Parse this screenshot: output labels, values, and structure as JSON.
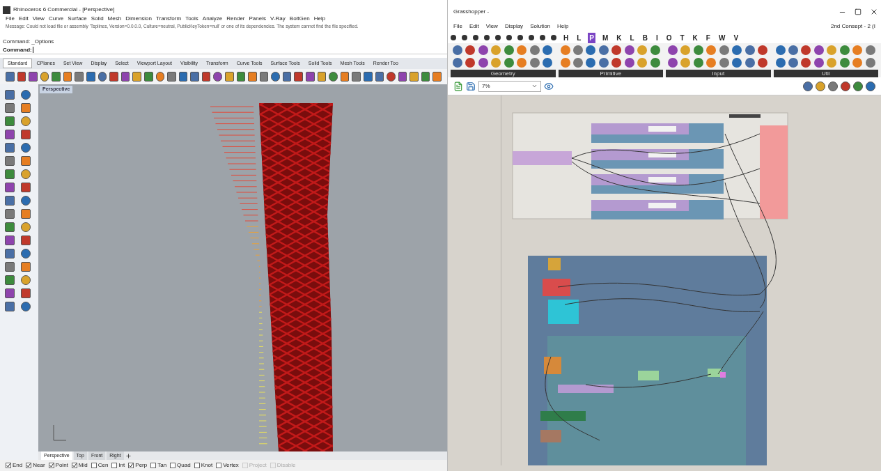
{
  "rhino": {
    "title": "Rhinoceros 6 Commercial - [Perspective]",
    "menu": [
      "File",
      "Edit",
      "View",
      "Curve",
      "Surface",
      "Solid",
      "Mesh",
      "Dimension",
      "Transform",
      "Tools",
      "Analyze",
      "Render",
      "Panels",
      "V-Ray",
      "BoltGen",
      "Help"
    ],
    "message": "Message: Could not load file or assembly 'Tsplines, Version=0.0.0.0, Culture=neutral, PublicKeyToken=null' or one of its dependencies. The system cannot find the file specified.",
    "command_history": "Command: _Options",
    "command_prompt": "Command:",
    "toolbar_tabs": [
      {
        "label": "Standard",
        "selected": true
      },
      {
        "label": "CPlanes",
        "selected": false
      },
      {
        "label": "Set View",
        "selected": false
      },
      {
        "label": "Display",
        "selected": false
      },
      {
        "label": "Select",
        "selected": false
      },
      {
        "label": "Viewport Layout",
        "selected": false
      },
      {
        "label": "Visibility",
        "selected": false
      },
      {
        "label": "Transform",
        "selected": false
      },
      {
        "label": "Curve Tools",
        "selected": false
      },
      {
        "label": "Surface Tools",
        "selected": false
      },
      {
        "label": "Solid Tools",
        "selected": false
      },
      {
        "label": "Mesh Tools",
        "selected": false
      },
      {
        "label": "Render Too",
        "selected": false
      }
    ],
    "viewport_title": "Perspective",
    "viewport_tabs": [
      {
        "label": "Perspective",
        "selected": true
      },
      {
        "label": "Top",
        "selected": false
      },
      {
        "label": "Front",
        "selected": false
      },
      {
        "label": "Right",
        "selected": false
      }
    ],
    "osnaps": [
      {
        "label": "End",
        "checked": true,
        "disabled": false
      },
      {
        "label": "Near",
        "checked": true,
        "disabled": false
      },
      {
        "label": "Point",
        "checked": true,
        "disabled": false
      },
      {
        "label": "Mid",
        "checked": true,
        "disabled": false
      },
      {
        "label": "Cen",
        "checked": false,
        "disabled": false
      },
      {
        "label": "Int",
        "checked": false,
        "disabled": false
      },
      {
        "label": "Perp",
        "checked": true,
        "disabled": false
      },
      {
        "label": "Tan",
        "checked": false,
        "disabled": false
      },
      {
        "label": "Quad",
        "checked": false,
        "disabled": false
      },
      {
        "label": "Knot",
        "checked": false,
        "disabled": false
      },
      {
        "label": "Vertex",
        "checked": false,
        "disabled": false
      },
      {
        "label": "Project",
        "checked": false,
        "disabled": true
      },
      {
        "label": "Disable",
        "checked": false,
        "disabled": true
      }
    ]
  },
  "grasshopper": {
    "title": "Grasshopper -",
    "menu": [
      "File",
      "Edit",
      "View",
      "Display",
      "Solution",
      "Help"
    ],
    "document_title": "2nd Consept - 2 (I",
    "component_tabs": [
      {
        "label": "H",
        "selected": false
      },
      {
        "label": "L",
        "selected": false
      },
      {
        "label": "P",
        "selected": true
      },
      {
        "label": "M",
        "selected": false
      },
      {
        "label": "K",
        "selected": false
      },
      {
        "label": "L",
        "selected": false
      },
      {
        "label": "B",
        "selected": false
      },
      {
        "label": "I",
        "selected": false
      },
      {
        "label": "O",
        "selected": false
      },
      {
        "label": "T",
        "selected": false
      },
      {
        "label": "K",
        "selected": false
      },
      {
        "label": "F",
        "selected": false
      },
      {
        "label": "W",
        "selected": false
      },
      {
        "label": "V",
        "selected": false
      }
    ],
    "panel_groups": [
      "Geometry",
      "Primitive",
      "Input",
      "Util"
    ],
    "zoom": "7%"
  }
}
